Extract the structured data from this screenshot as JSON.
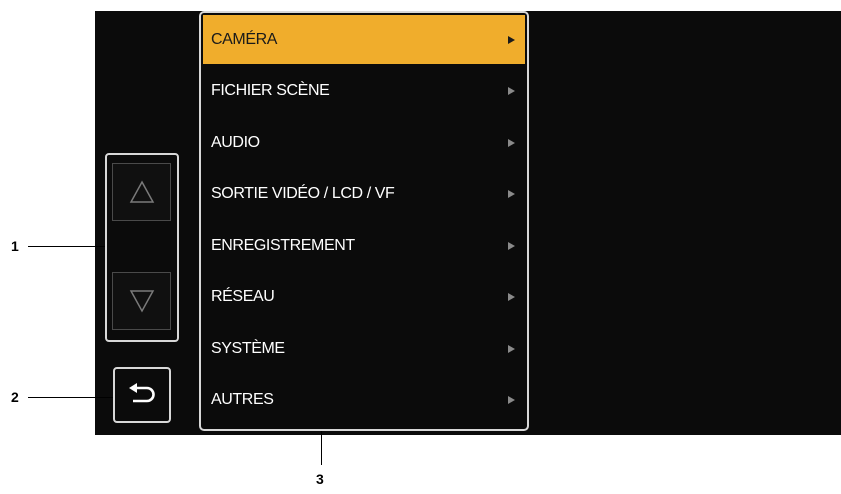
{
  "menu": {
    "items": [
      {
        "label": "CAMÉRA",
        "selected": true
      },
      {
        "label": "FICHIER SCÈNE",
        "selected": false
      },
      {
        "label": "AUDIO",
        "selected": false
      },
      {
        "label": "SORTIE VIDÉO / LCD / VF",
        "selected": false
      },
      {
        "label": "ENREGISTREMENT",
        "selected": false
      },
      {
        "label": "RÉSEAU",
        "selected": false
      },
      {
        "label": "SYSTÈME",
        "selected": false
      },
      {
        "label": "AUTRES",
        "selected": false
      }
    ],
    "submenu_icon": "triangle-right-icon"
  },
  "controls": {
    "scroll_up_icon": "triangle-up-outline-icon",
    "scroll_down_icon": "triangle-down-outline-icon",
    "back_icon": "return-arrow-icon"
  },
  "callouts": {
    "one": "1",
    "two": "2",
    "three": "3"
  },
  "colors": {
    "screen_background": "#0b0b0b",
    "selected_item": "#f0ad2c",
    "frame": "#d8d8d8",
    "text": "#ffffff"
  }
}
